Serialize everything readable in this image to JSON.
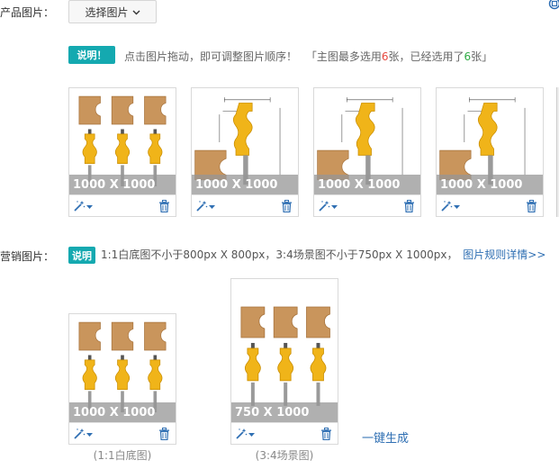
{
  "product_images": {
    "label": "产品图片：",
    "select_button": "选择图片",
    "badge": "说明！",
    "instruction": "点击图片拖动，即可调整图片顺序！",
    "count_prefix": "「主图最多选用",
    "max_count": "6",
    "count_mid": "张，已经选用了",
    "used_count": "6",
    "count_suffix": "张」",
    "cards": [
      {
        "size": "1000 X 1000",
        "variant": "three-bits"
      },
      {
        "size": "1000 X 1000",
        "variant": "spec-drawing"
      },
      {
        "size": "1000 X 1000",
        "variant": "spec-drawing"
      },
      {
        "size": "1000 X 1000",
        "variant": "spec-drawing"
      }
    ]
  },
  "marketing_images": {
    "label": "营销图片：",
    "badge": "说明",
    "instruction": "1:1白底图不小于800px X 800px，3:4场景图不小于750px X 1000px，",
    "rules_link": "图片规则详情>>",
    "cards": [
      {
        "size": "1000 X 1000",
        "caption": "(1:1白底图)"
      },
      {
        "size": "750 X 1000",
        "caption": "(3:4场景图)"
      }
    ],
    "generate_link": "一键生成"
  },
  "colors": {
    "accent_teal": "#14a9b0",
    "link_blue": "#2f6fb3",
    "count_red": "#e6463c",
    "count_green": "#2eaa43",
    "bit_yellow": "#f0b419",
    "wood_tan": "#c9955c"
  },
  "icons": [
    "chevron-down-icon",
    "magic-wand-icon",
    "trash-icon",
    "window-corner-icon"
  ]
}
